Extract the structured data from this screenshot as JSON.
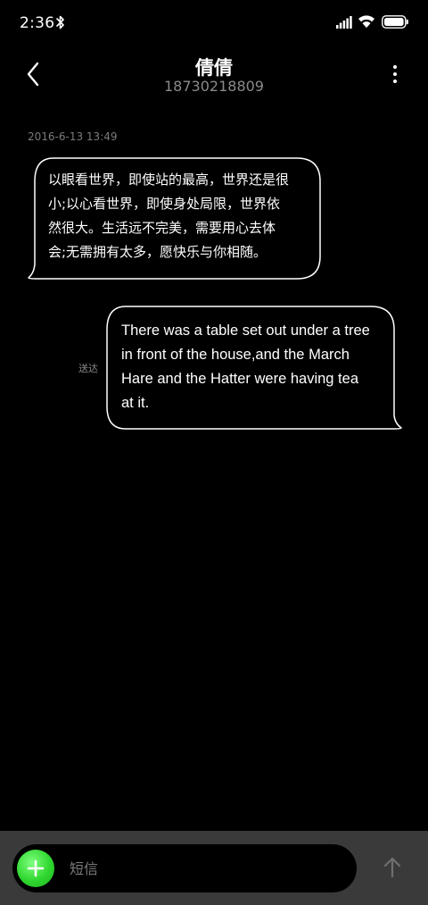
{
  "status_bar": {
    "time": "2:36",
    "icons": [
      "bluetooth-icon",
      "signal-icon",
      "wifi-icon",
      "battery-icon"
    ]
  },
  "header": {
    "contact_name": "倩倩",
    "contact_number": "18730218809",
    "back_icon": "chevron-left-icon",
    "more_icon": "more-vertical-icon"
  },
  "conversation": {
    "timestamp": "2016-6-13 13:49",
    "messages": [
      {
        "direction": "incoming",
        "lines": [
          "以眼看世界，即使站的最高，世界还是很",
          "小;以心看世界，即使身处局限，世界依",
          "然很大。生活远不完美，需要用心去体",
          "会;无需拥有太多，愿快乐与你相随。"
        ]
      },
      {
        "direction": "outgoing",
        "status": "送达",
        "lines": [
          "There was a table set out under a tree",
          "in front of the house,and the March",
          "Hare and the Hatter were having tea",
          "at it."
        ]
      }
    ]
  },
  "composer": {
    "placeholder": "短信",
    "value": "",
    "attach_icon": "plus-icon",
    "send_icon": "arrow-up-icon"
  },
  "colors": {
    "background": "#000000",
    "composer_bar": "#3a3a3a",
    "accent_green": "#2fd62f",
    "muted_text": "#8a8a8a"
  }
}
